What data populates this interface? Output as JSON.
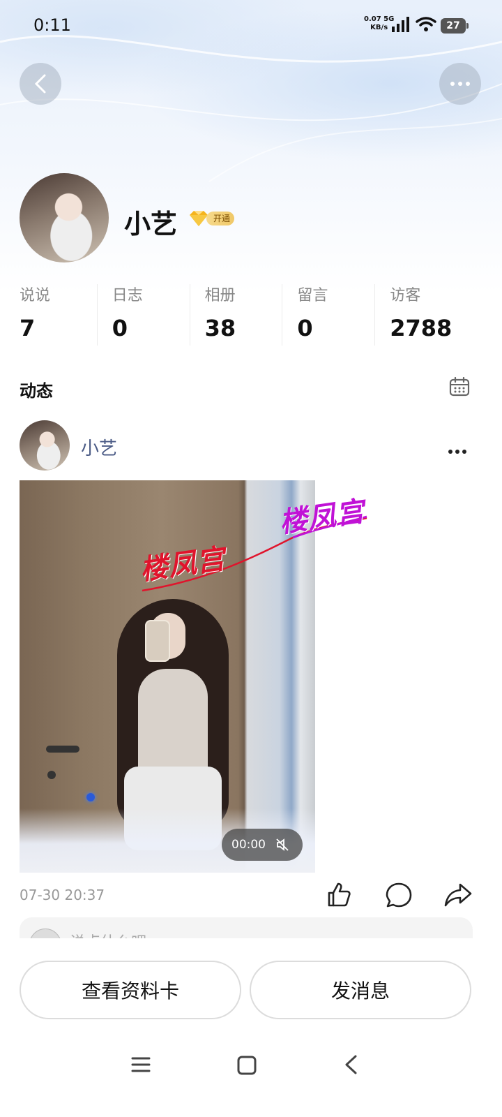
{
  "status_bar": {
    "time": "0:11",
    "net_speed": "0.07",
    "net_unit": "KB/s",
    "network": "5G",
    "battery": "27"
  },
  "header": {
    "back_icon": "chevron-left-icon",
    "more_icon": "ellipsis-icon"
  },
  "profile": {
    "name": "小艺",
    "vip_label": "开通"
  },
  "stats": [
    {
      "label": "说说",
      "value": "7"
    },
    {
      "label": "日志",
      "value": "0"
    },
    {
      "label": "相册",
      "value": "38"
    },
    {
      "label": "留言",
      "value": "0"
    },
    {
      "label": "访客",
      "value": "2788"
    }
  ],
  "feed": {
    "title": "动态",
    "calendar_icon": "calendar-icon"
  },
  "post": {
    "author": "小艺",
    "watermark_1": "楼凤宫",
    "watermark_2": "楼凤宫",
    "video_time": "00:00",
    "timestamp": "07-30 20:37",
    "comment_placeholder": "说点什么吧"
  },
  "actions": {
    "view_profile": "查看资料卡",
    "send_message": "发消息"
  },
  "colors": {
    "author_name": "#4a5a85",
    "watermark_red": "#e0142c",
    "watermark_purple": "#c012d6"
  }
}
